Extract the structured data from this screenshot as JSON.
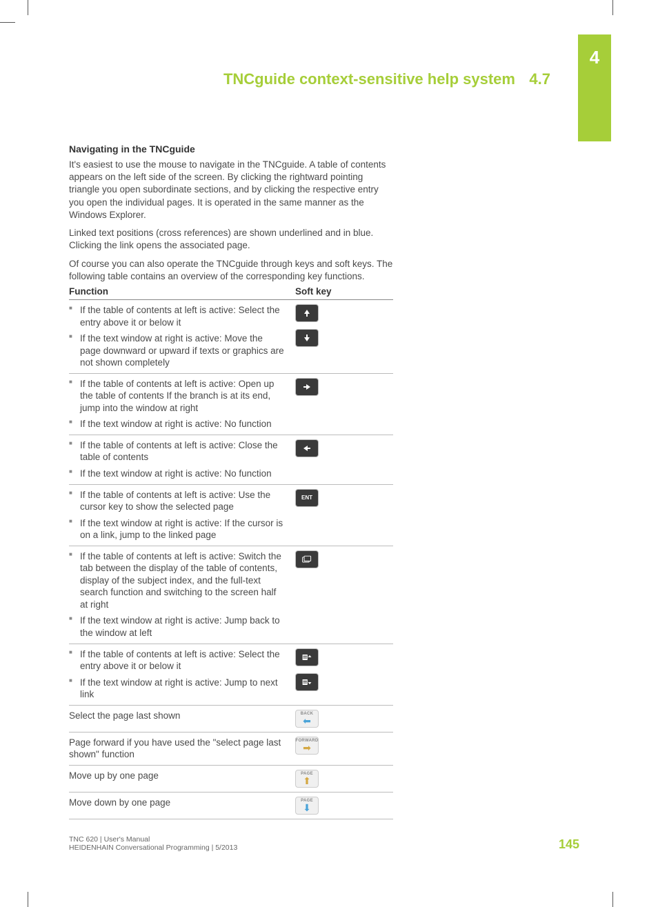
{
  "chapter_tab": "4",
  "header": {
    "title": "TNCguide context-sensitive help system",
    "section": "4.7"
  },
  "intro": {
    "heading": "Navigating in the TNCguide",
    "p1": "It's easiest to use the mouse to navigate in the TNCguide. A table of contents appears on the left side of the screen. By clicking the rightward pointing triangle you open subordinate sections, and by clicking the respective entry you open the individual pages. It is operated in the same manner as the Windows Explorer.",
    "p2": "Linked text positions (cross references) are shown underlined and in blue. Clicking the link opens the associated page.",
    "p3": "Of course you can also operate the TNCguide through keys and soft keys. The following table contains an overview of the corresponding key functions."
  },
  "table": {
    "head_func": "Function",
    "head_key": "Soft key",
    "rows": [
      {
        "items": [
          "If the table of contents at left is active: Select the entry above it or below it",
          "If the text window at right is active: Move the page downward or upward if texts or graphics are not shown completely"
        ],
        "keys": [
          "arrow-up",
          "arrow-down"
        ]
      },
      {
        "items": [
          "If the table of contents at left is active: Open up the table of contents If the branch is at its end, jump into the window at right",
          "If the text window at right is active: No function"
        ],
        "keys": [
          "arrow-right"
        ]
      },
      {
        "items": [
          "If the table of contents at left is active: Close the table of contents",
          "If the text window at right is active: No function"
        ],
        "keys": [
          "arrow-left"
        ]
      },
      {
        "items": [
          "If the table of contents at left is active: Use the cursor key to show the selected page",
          "If the text window at right is active: If the cursor is on a link, jump to the linked page"
        ],
        "keys": [
          "ent"
        ]
      },
      {
        "items": [
          "If the table of contents at left is active: Switch the tab between the display of the table of contents, display of the subject index, and the full-text search function and switching to the screen half at right",
          "If the text window at right is active: Jump back to the window at left"
        ],
        "keys": [
          "tab-switch"
        ]
      },
      {
        "items": [
          "If the table of contents at left is active: Select the entry above it or below it",
          "If the text window at right is active: Jump to next link"
        ],
        "keys": [
          "list-up",
          "list-down"
        ]
      },
      {
        "plain": "Select the page last shown",
        "keys": [
          "back"
        ]
      },
      {
        "plain": "Page forward if you have used the \"select page last shown\" function",
        "keys": [
          "forward"
        ]
      },
      {
        "plain": "Move up by one page",
        "keys": [
          "page-up"
        ]
      },
      {
        "plain": "Move down by one page",
        "keys": [
          "page-down"
        ]
      }
    ]
  },
  "key_labels": {
    "back": "BACK",
    "forward": "FORWARD",
    "page": "PAGE",
    "ent": "ENT"
  },
  "footer": {
    "line1": "TNC 620 | User's Manual",
    "line2": "HEIDENHAIN Conversational Programming | 5/2013",
    "page": "145"
  }
}
